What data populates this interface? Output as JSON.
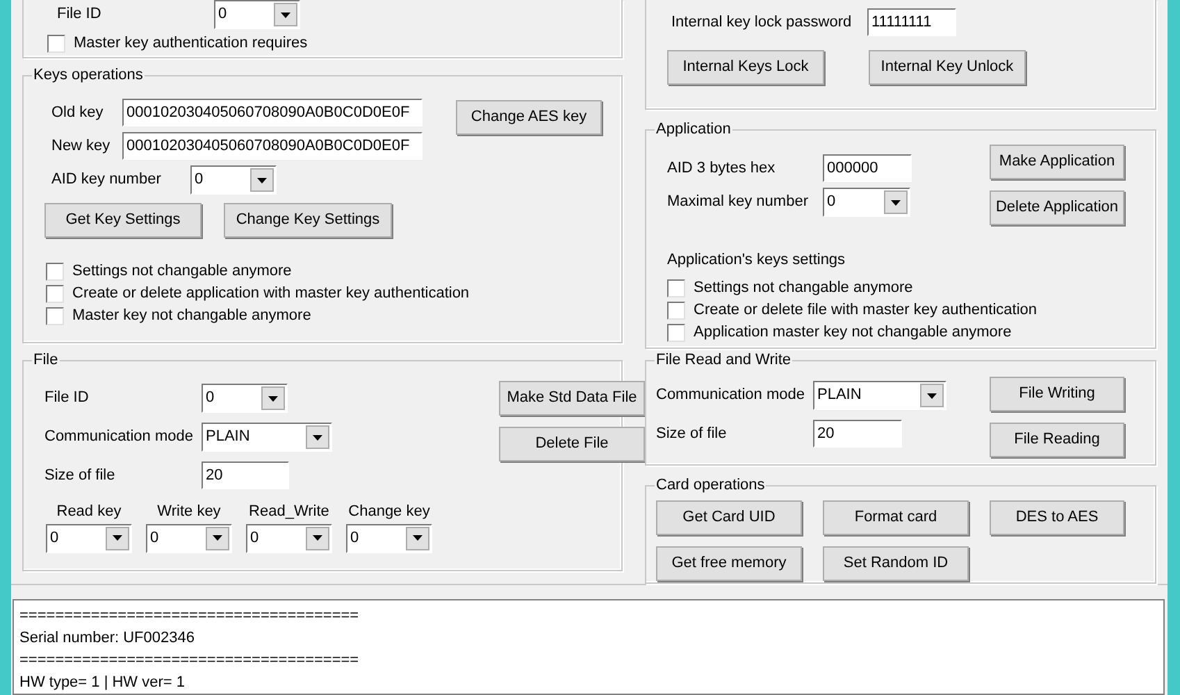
{
  "reader_group": {
    "file_id": {
      "label": "File ID",
      "value": "0"
    },
    "checkbox": {
      "label": "Master key authentication requires",
      "checked": false
    }
  },
  "lock_group": {
    "password": {
      "label": "Internal key lock password",
      "value": "11111111"
    },
    "buttons": [
      "Internal Keys Lock",
      "Internal Key Unlock"
    ]
  },
  "keys_operations": {
    "title": "Keys operations",
    "old_key": {
      "label": "Old key",
      "value": "000102030405060708090A0B0C0D0E0F"
    },
    "new_key": {
      "label": "New key",
      "value": "000102030405060708090A0B0C0D0E0F"
    },
    "change_button": "Change AES key",
    "aid_key_number": {
      "label": "AID key number",
      "value": "0"
    },
    "buttons": [
      "Get Key Settings",
      "Change Key Settings"
    ],
    "checkboxes": [
      {
        "label": "Settings not changable anymore",
        "checked": false
      },
      {
        "label": "Create or delete application with master key authentication",
        "checked": false
      },
      {
        "label": "Master key not changable anymore",
        "checked": false
      }
    ]
  },
  "application": {
    "title": "Application",
    "aid": {
      "label": "AID 3 bytes hex",
      "value": "000000"
    },
    "max_key": {
      "label": "Maximal key number",
      "value": "0"
    },
    "buttons": [
      "Make Application",
      "Delete Application"
    ],
    "settings_label": "Application's keys settings",
    "checkboxes": [
      {
        "label": "Settings not changable anymore",
        "checked": false
      },
      {
        "label": "Create or delete file with master key authentication",
        "checked": false
      },
      {
        "label": "Application master key not changable anymore",
        "checked": false
      }
    ]
  },
  "file": {
    "title": "File",
    "file_id": {
      "label": "File ID",
      "value": "0"
    },
    "comm_mode": {
      "label": "Communication mode",
      "value": "PLAIN"
    },
    "size": {
      "label": "Size of file",
      "value": "20"
    },
    "buttons": [
      "Make Std Data File",
      "Delete File"
    ],
    "keys": [
      {
        "label": "Read key",
        "value": "0"
      },
      {
        "label": "Write key",
        "value": "0"
      },
      {
        "label": "Read_Write",
        "value": "0"
      },
      {
        "label": "Change key",
        "value": "0"
      }
    ]
  },
  "file_read_write": {
    "title": "File Read and Write",
    "comm_mode": {
      "label": "Communication mode",
      "value": "PLAIN"
    },
    "size": {
      "label": "Size of file",
      "value": "20"
    },
    "buttons": [
      "File Writing",
      "File Reading"
    ]
  },
  "card_operations": {
    "title": "Card operations",
    "buttons": [
      "Get Card UID",
      "Format card",
      "DES to AES",
      "Get free memory",
      "Set Random ID"
    ]
  },
  "log": [
    "======================================",
    "Serial number: UF002346",
    "======================================",
    "HW type= 1 | HW ver= 1"
  ]
}
